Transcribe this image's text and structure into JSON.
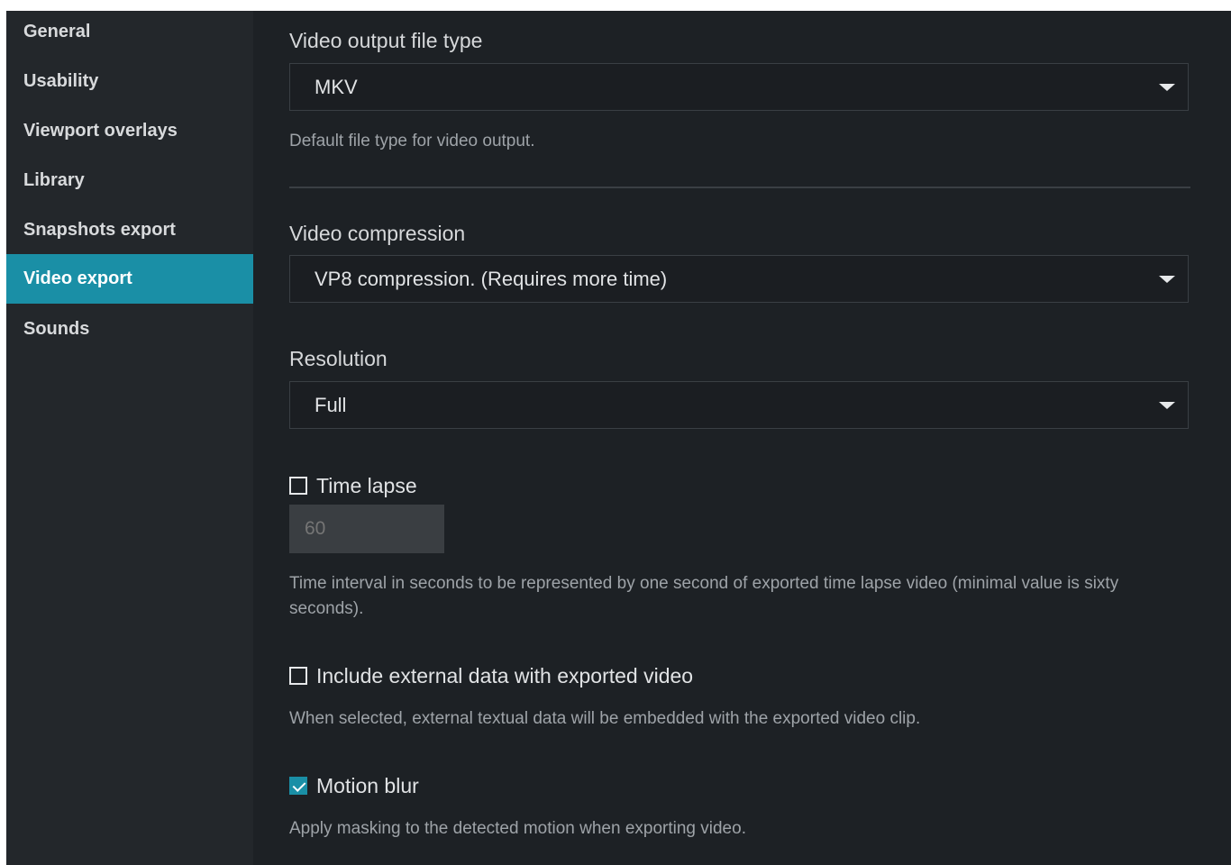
{
  "sidebar": {
    "items": [
      {
        "label": "General"
      },
      {
        "label": "Usability"
      },
      {
        "label": "Viewport overlays"
      },
      {
        "label": "Library"
      },
      {
        "label": "Snapshots export"
      },
      {
        "label": "Video export",
        "active": true
      },
      {
        "label": "Sounds"
      }
    ]
  },
  "video_output": {
    "label": "Video output file type",
    "value": "MKV",
    "description": "Default file type for video output."
  },
  "video_compression": {
    "label": "Video compression",
    "value": "VP8 compression. (Requires more time)"
  },
  "resolution": {
    "label": "Resolution",
    "value": "Full"
  },
  "time_lapse": {
    "label": "Time lapse",
    "checked": false,
    "placeholder": "60",
    "description": "Time interval in seconds to be represented by one second of exported time lapse video (minimal value is sixty seconds)."
  },
  "external_data": {
    "label": "Include external data with exported video",
    "checked": false,
    "description": "When selected, external textual data will be embedded with the exported video clip."
  },
  "motion_blur": {
    "label": "Motion blur",
    "checked": true,
    "description": "Apply masking to the detected motion when exporting video."
  },
  "colors": {
    "accent": "#1a8fa6",
    "background": "#1d2125",
    "sidebar": "#23272b"
  }
}
